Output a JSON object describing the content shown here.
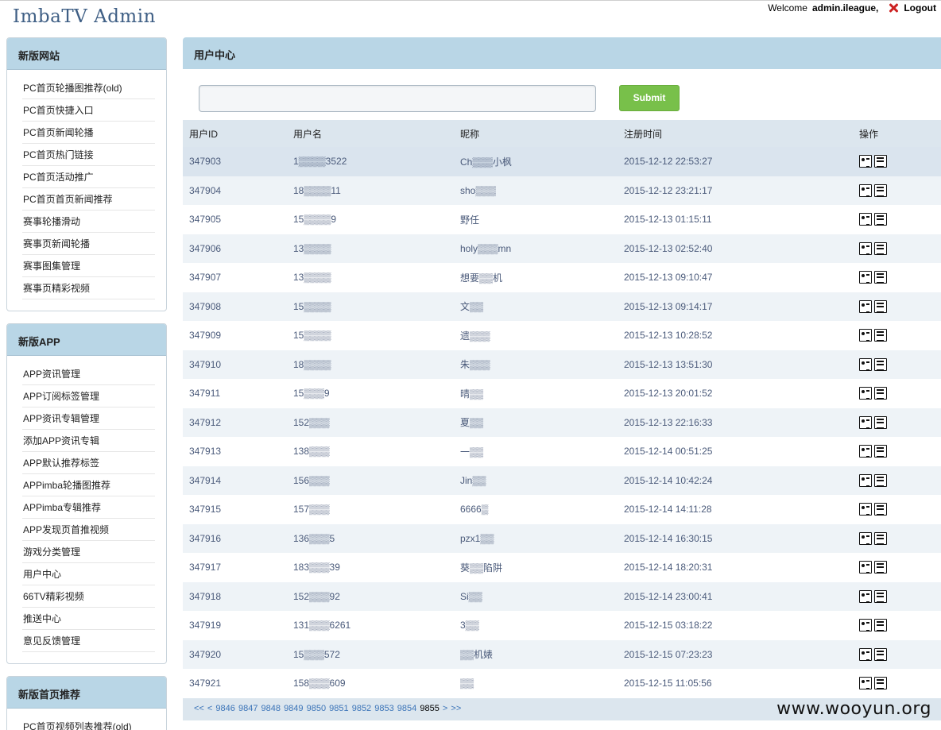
{
  "header": {
    "app_title": "ImbaTV Admin",
    "welcome_label": "Welcome",
    "username": "admin.ileague,",
    "logout_label": "Logout"
  },
  "sidebar": {
    "panels": [
      {
        "title": "新版网站",
        "items": [
          "PC首页轮播图推荐(old)",
          "PC首页快捷入口",
          "PC首页新闻轮播",
          "PC首页热门链接",
          "PC首页活动推广",
          "PC首页首页新闻推荐",
          "赛事轮播滑动",
          "赛事页新闻轮播",
          "赛事图集管理",
          "赛事页精彩视频"
        ]
      },
      {
        "title": "新版APP",
        "items": [
          "APP资讯管理",
          "APP订阅标签管理",
          "APP资讯专辑管理",
          "添加APP资讯专辑",
          "APP默认推荐标签",
          "APPimba轮播图推荐",
          "APPimba专辑推荐",
          "APP发现页首推视频",
          "游戏分类管理",
          "用户中心",
          "66TV精彩视频",
          "推送中心",
          "意见反馈管理"
        ]
      },
      {
        "title": "新版首页推荐",
        "items": [
          "PC首页视频列表推荐(old)"
        ]
      }
    ]
  },
  "main": {
    "title": "用户中心",
    "search_value": "",
    "submit_label": "Submit",
    "columns": [
      "用户ID",
      "用户名",
      "昵称",
      "注册时间",
      "操作"
    ],
    "rows": [
      {
        "id": "347903",
        "username": "1▒▒▒▒3522",
        "nickname": "Ch▒▒▒小枫",
        "time": "2015-12-12 22:53:27"
      },
      {
        "id": "347904",
        "username": "18▒▒▒▒11",
        "nickname": "sho▒▒▒",
        "time": "2015-12-12 23:21:17"
      },
      {
        "id": "347905",
        "username": "15▒▒▒▒9",
        "nickname": "野任",
        "time": "2015-12-13 01:15:11"
      },
      {
        "id": "347906",
        "username": "13▒▒▒▒",
        "nickname": "holy▒▒▒mn",
        "time": "2015-12-13 02:52:40"
      },
      {
        "id": "347907",
        "username": "13▒▒▒▒",
        "nickname": "想要▒▒机",
        "time": "2015-12-13 09:10:47"
      },
      {
        "id": "347908",
        "username": "15▒▒▒▒",
        "nickname": "文▒▒",
        "time": "2015-12-13 09:14:17"
      },
      {
        "id": "347909",
        "username": "15▒▒▒▒",
        "nickname": "遗▒▒▒",
        "time": "2015-12-13 10:28:52"
      },
      {
        "id": "347910",
        "username": "18▒▒▒▒",
        "nickname": "朱▒▒▒",
        "time": "2015-12-13 13:51:30"
      },
      {
        "id": "347911",
        "username": "15▒▒▒9",
        "nickname": "晴▒▒",
        "time": "2015-12-13 20:01:52"
      },
      {
        "id": "347912",
        "username": "152▒▒▒",
        "nickname": "夏▒▒",
        "time": "2015-12-13 22:16:33"
      },
      {
        "id": "347913",
        "username": "138▒▒▒",
        "nickname": "一▒▒",
        "time": "2015-12-14 00:51:25"
      },
      {
        "id": "347914",
        "username": "156▒▒▒",
        "nickname": "Jin▒▒",
        "time": "2015-12-14 10:42:24"
      },
      {
        "id": "347915",
        "username": "157▒▒▒",
        "nickname": "6666▒",
        "time": "2015-12-14 14:11:28"
      },
      {
        "id": "347916",
        "username": "136▒▒▒5",
        "nickname": "pzx1▒▒",
        "time": "2015-12-14 16:30:15"
      },
      {
        "id": "347917",
        "username": "183▒▒▒39",
        "nickname": "葵▒▒陷阱",
        "time": "2015-12-14 18:20:31"
      },
      {
        "id": "347918",
        "username": "152▒▒▒92",
        "nickname": "Si▒▒",
        "time": "2015-12-14 23:00:41"
      },
      {
        "id": "347919",
        "username": "131▒▒▒6261",
        "nickname": "3▒▒",
        "time": "2015-12-15 03:18:22"
      },
      {
        "id": "347920",
        "username": "15▒▒▒572",
        "nickname": "▒▒机婊",
        "time": "2015-12-15 07:23:23"
      },
      {
        "id": "347921",
        "username": "158▒▒▒609",
        "nickname": "▒▒",
        "time": "2015-12-15 11:05:56"
      }
    ],
    "pager": [
      "<<",
      "<",
      "9846",
      "9847",
      "9848",
      "9849",
      "9850",
      "9851",
      "9852",
      "9853",
      "9854",
      "9855",
      ">",
      ">>"
    ],
    "pager_current": "9855"
  },
  "watermark": "www.wooyun.org"
}
